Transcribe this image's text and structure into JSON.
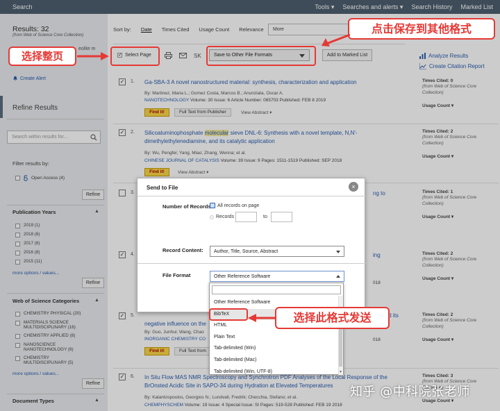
{
  "topbar": {
    "title": "Search",
    "nav": [
      "Tools ▾",
      "Searches and alerts ▾",
      "Search History",
      "Marked List"
    ]
  },
  "sidebar": {
    "results_count": "Results: 32",
    "results_source": "(from Web of Science Core Collection)",
    "hidden_snippet": "eolite m",
    "create_alert": "Create Alert",
    "refine_title": "Refine Results",
    "search_placeholder": "Search within results for...",
    "filter_label": "Filter results by:",
    "open_access": "Open Access (4)",
    "refine_button": "Refine",
    "pub_years": {
      "title": "Publication Years",
      "items": [
        "2019 (1)",
        "2018 (6)",
        "2017 (6)",
        "2016 (8)",
        "2015 (11)"
      ],
      "more": "more options / values..."
    },
    "wos_categories": {
      "title": "Web of Science Categories",
      "items": [
        "CHEMISTRY PHYSICAL (20)",
        "MATERIALS SCIENCE MULTIDISCIPLINARY (16)",
        "CHEMISTRY APPLIED (8)",
        "NANOSCIENCE NANOTECHNOLOGY (6)",
        "CHEMISTRY MULTIDISCIPLINARY (5)"
      ],
      "more": "more options / values..."
    },
    "doc_types": {
      "title": "Document Types"
    }
  },
  "main": {
    "sort_label": "Sort by:",
    "sort_options": [
      "Date",
      "Times Cited",
      "Usage Count",
      "Relevance"
    ],
    "sort_more": "More",
    "select_page": "Select Page",
    "sk_label": "SK",
    "export_select": "Save to Other File Formats",
    "add_marked": "Add to Marked List",
    "analyze": "Analyze Results",
    "citation_report": "Create Citation Report"
  },
  "records": [
    {
      "num": "1.",
      "title": "Ga-SBA-3 A novel nanostructured material: synthesis, characterization and application",
      "authors": "By: Martinez, Maria L.; Gomez Costa, Marcos B.; Anunziata, Oscar A.",
      "journal": "NANOTECHNOLOGY",
      "meta": " Volume: 30  Issue: 6  Article Number: 065703  Published: FEB 8 2019",
      "times_cited": "Times Cited: 0",
      "source": "(from Web of Science Core Collection)",
      "usage": "Usage Count ▾",
      "findit": "Find it!",
      "fulltext": "Full Text from Publisher",
      "viewabs": "View Abstract ▾"
    },
    {
      "num": "2.",
      "title_pre": "Silicoaluminophosphate ",
      "title_hl": "molecular",
      "title_post": " sieve DNL-6: Synthesis with a novel template, N,N'-dimethylethylenediamine, and its catalytic application",
      "authors": "By: Wu, Pengfei; Yang, Miao; Zhang, Wenna; et al.",
      "journal": "CHINESE JOURNAL OF CATALYSIS",
      "meta": "  Volume: 39  Issue: 9  Pages: 1511-1519  Published: SEP 2018",
      "times_cited": "Times Cited: 2",
      "source": "(from Web of Science Core Collection)",
      "usage": "Usage Count ▾",
      "findit": "Find it!",
      "viewabs": "View Abstract ▾"
    },
    {
      "num": "3.",
      "title_tail": "ng to",
      "times_cited": "Times Cited: 1",
      "source": "(from Web of Science Core Collection)",
      "usage": "Usage Count ▾"
    },
    {
      "num": "4.",
      "title_tail": "ing",
      "meta_tail": "018",
      "times_cited": "Times Cited: 2",
      "source": "(from Web of Science Core Collection)",
      "usage": "Usage Count ▾"
    },
    {
      "num": "5.",
      "title_a": "ent and its",
      "title_b": "negative influence on the",
      "authors": "By: Guo, Junhui; Wang, Chao",
      "journal": "INORGANIC CHEMISTRY CO",
      "meta_tail": "018",
      "times_cited": "Times Cited: 2",
      "source": "(from Web of Science Core Collection)",
      "usage": "Usage Count ▾",
      "findit": "Find it!",
      "fulltext": "Full Text from"
    },
    {
      "num": "6.",
      "title": "In Situ Flow MAS NMR Spectroscopy and Synchrotron PDF Analyses of the Local Response of the BrOnsted Acidic Site in SAPO-34 during Hydration at Elevated Temperatures",
      "authors": "By: Kalantzopoulos, Georgios N.; Lundvall, Fredrik; Checchia, Stefano; et al.",
      "journal": "CHEMPHYSCHEM",
      "meta": "  Volume: 19  Issue: 4  Special Issue: SI  Pages: 519-528  Published: FEB 19 2018",
      "times_cited": "Times Cited: 3",
      "source": "(from Web of Science Core Collection)",
      "usage": "Usage Count ▾"
    }
  ],
  "modal": {
    "title": "Send to File",
    "close": "×",
    "num_records_label": "Number of Records:",
    "all_records": "All records on page",
    "records_label": "Records",
    "to_label": "to",
    "record_content_label": "Record Content:",
    "record_content_value": "Author, Title, Source, Abstract",
    "file_format_label": "File Format",
    "file_format_value": "Other Reference Software",
    "options": [
      "Other Reference Software",
      "BibTeX",
      "HTML",
      "Plain Text",
      "Tab-delimited (Win)",
      "Tab-delimited (Mac)",
      "Tab-delimited (Win, UTF-8)"
    ],
    "selected_index": 1
  },
  "annotations": {
    "select_page": "选择整页",
    "save_formats": "点击保存到其他格式",
    "choose_format": "选择此格式发送"
  },
  "watermark": "知乎 @中科院张老师",
  "colors": {
    "annotation_red": "#e53935",
    "link_blue": "#2a5db0",
    "topbar": "#4e5f70",
    "findit_yellow": "#fbd84a"
  }
}
